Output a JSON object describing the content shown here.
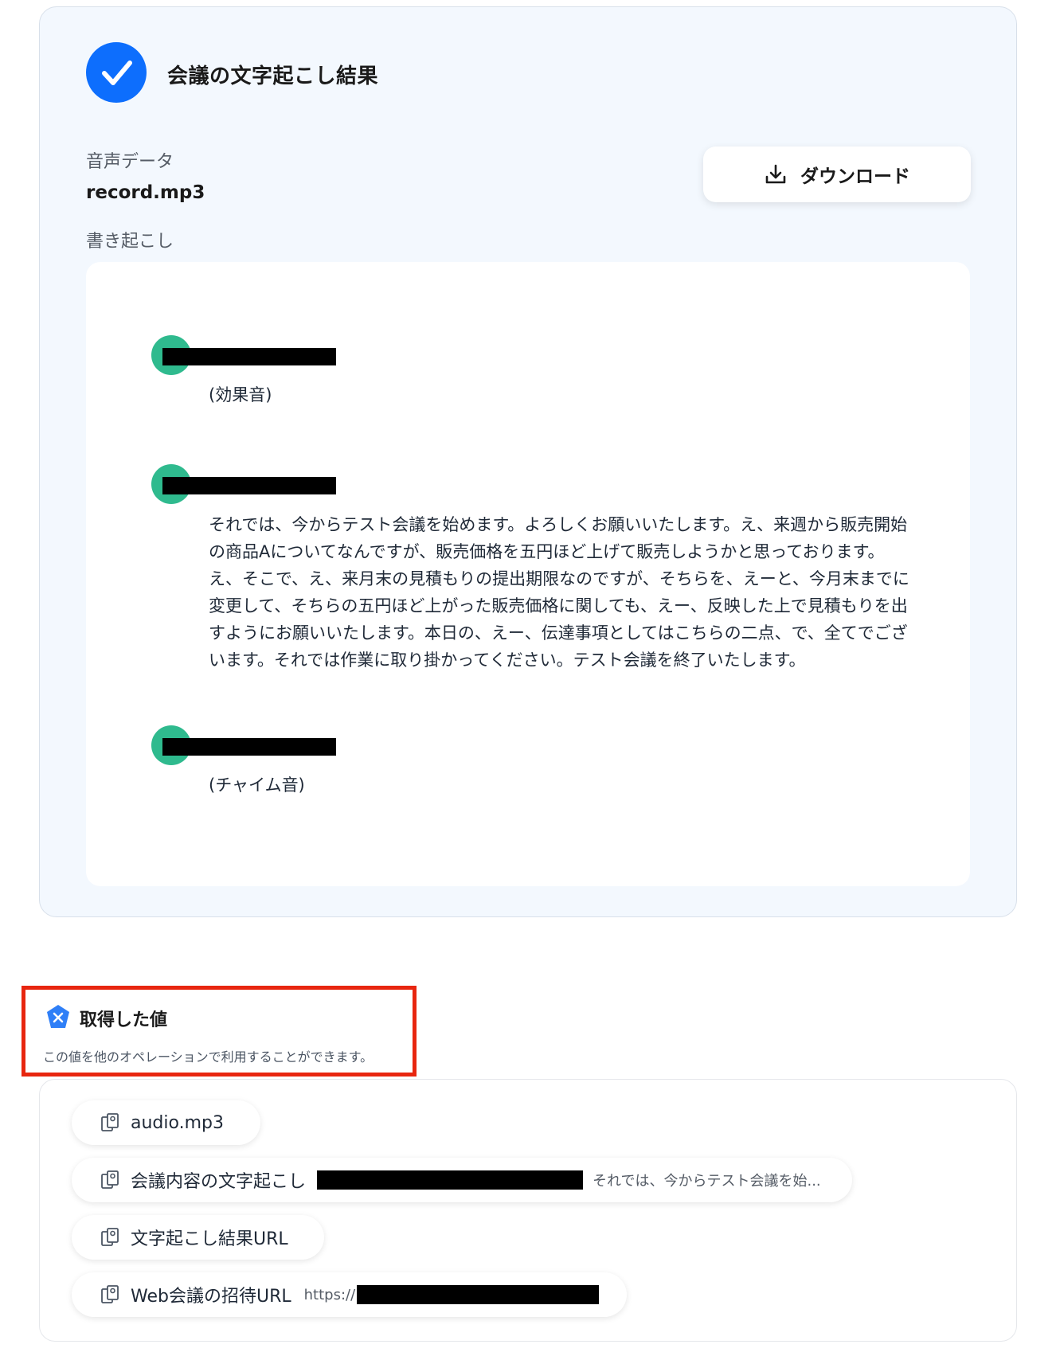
{
  "result": {
    "title": "会議の文字起こし結果",
    "audio_label": "音声データ",
    "audio_file": "record.mp3",
    "transcript_label": "書き起こし",
    "download_label": "ダウンロード",
    "utterances": [
      {
        "text": "(効果音)"
      },
      {
        "text": "それでは、今からテスト会議を始めます。よろしくお願いいたします。え、来週から販売開始の商品Aについてなんですが、販売価格を五円ほど上げて販売しようかと思っております。え、そこで、え、来月末の見積もりの提出期限なのですが、そちらを、えーと、今月末までに変更して、そちらの五円ほど上がった販売価格に関しても、えー、反映した上で見積もりを出すようにお願いいたします。本日の、えー、伝達事項としてはこちらの二点、で、全てでございます。それでは作業に取り掛かってください。テスト会議を終了いたします。"
      },
      {
        "text": "(チャイム音)"
      }
    ]
  },
  "acquired": {
    "title": "取得した値",
    "description": "この値を他のオペレーションで利用することができます。",
    "items": [
      {
        "name": "audio.mp3",
        "preview": ""
      },
      {
        "name": "会議内容の文字起こし",
        "preview": "それでは、今からテスト会議を始..."
      },
      {
        "name": "文字起こし結果URL",
        "preview": ""
      },
      {
        "name": "Web会議の招待URL",
        "preview": "https://"
      }
    ]
  },
  "colors": {
    "accent": "#0d6efd",
    "speaker": "#2fba8e",
    "highlight_border": "#e8260f",
    "card_background": "#f3f8fe"
  },
  "icons": {
    "check": "check-icon",
    "download": "download-icon",
    "acquired": "variable-icon",
    "item": "clipboard-icon"
  }
}
